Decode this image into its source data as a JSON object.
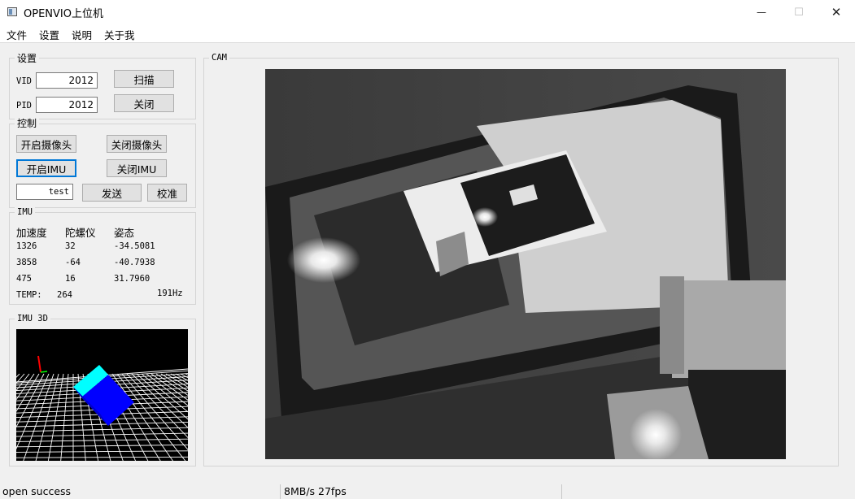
{
  "window": {
    "title": "OPENVIO上位机",
    "icon": "app-window-icon"
  },
  "window_controls": {
    "minimize": "—",
    "maximize": "☐",
    "close": "✕"
  },
  "menu": [
    "文件",
    "设置",
    "说明",
    "关于我"
  ],
  "settings": {
    "title": "设置",
    "vid_label": "VID",
    "vid_value": "2012",
    "pid_label": "PID",
    "pid_value": "2012",
    "scan_label": "扫描",
    "close_label": "关闭"
  },
  "control": {
    "title": "控制",
    "open_camera": "开启摄像头",
    "close_camera": "关闭摄像头",
    "open_imu": "开启IMU",
    "close_imu": "关闭IMU",
    "text_value": "test",
    "send": "发送",
    "calibrate": "校准"
  },
  "imu": {
    "title": "IMU",
    "headers": [
      "加速度",
      "陀螺仪",
      "姿态"
    ],
    "rows": [
      [
        "1326",
        "32",
        "-34.5081"
      ],
      [
        "3858",
        "-64",
        "-40.7938"
      ],
      [
        "475",
        "16",
        "31.7960"
      ]
    ],
    "temp_label": "TEMP:",
    "temp_value": "264",
    "rate": "191Hz"
  },
  "imu3d": {
    "title": "IMU 3D"
  },
  "cam": {
    "title": "CAM"
  },
  "status": {
    "left": "open success",
    "middle": "8MB/s 27fps"
  },
  "colors": {
    "cube_top": "#00ffff",
    "cube_side": "#0000ff",
    "axis": "#ff0000",
    "grid": "#ffffff",
    "view_bg": "#000000"
  }
}
